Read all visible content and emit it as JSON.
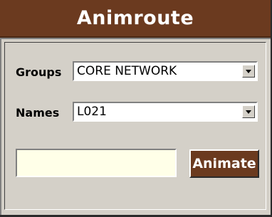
{
  "window": {
    "title": "Animroute"
  },
  "form": {
    "groups": {
      "label": "Groups",
      "value": "CORE NETWORK"
    },
    "names": {
      "label": "Names",
      "value": "L021"
    },
    "input": {
      "value": "",
      "placeholder": ""
    },
    "animate_label": "Animate"
  },
  "colors": {
    "accent": "#6b3a1f",
    "panel_bg": "#d4d0c8",
    "input_bg": "#ffffe8"
  }
}
